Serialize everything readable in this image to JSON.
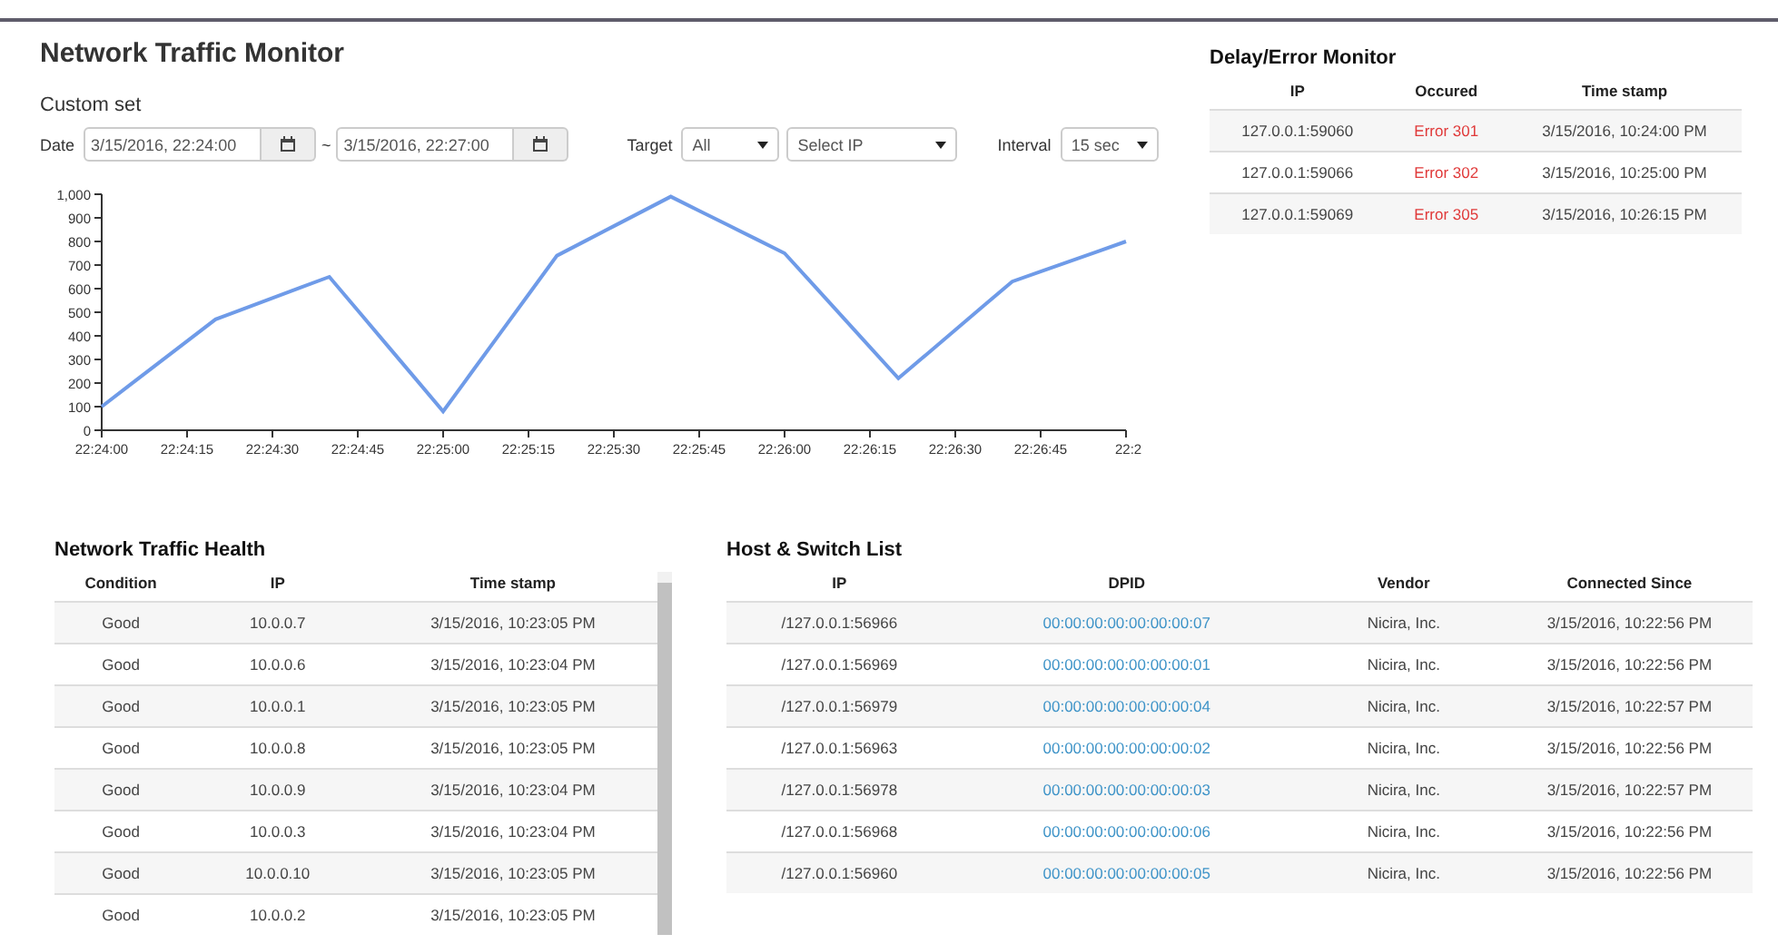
{
  "title": "Network Traffic Monitor",
  "custom_set": {
    "label": "Custom set",
    "date_label": "Date",
    "date_from": "3/15/2016, 22:24:00",
    "separator": "~",
    "date_to": "3/15/2016, 22:27:00",
    "target_label": "Target",
    "target_value": "All",
    "ip_placeholder": "Select IP",
    "interval_label": "Interval",
    "interval_value": "15 sec"
  },
  "chart": {
    "chart_data": {
      "type": "line",
      "categories": [
        "22:24:00",
        null,
        null,
        "22:24:15",
        null,
        null,
        "22:24:30",
        null,
        null,
        "22:24:45",
        null,
        null,
        "22:25:00",
        null,
        null,
        "22:25:15",
        null,
        null,
        "22:25:30",
        null,
        null,
        "22:25:45",
        null,
        null,
        "22:26:00",
        null,
        null,
        "22:26:15",
        null,
        null,
        "22:26:30",
        null,
        null,
        "22:26:45",
        null,
        null,
        "22:2"
      ],
      "series": [
        {
          "color": "#6f9be8",
          "values": [
            100,
            192.5,
            285,
            377.5,
            470,
            515,
            560,
            605,
            650,
            507.5,
            365,
            222.5,
            80,
            245,
            410,
            575,
            740,
            802.5,
            865,
            927.5,
            990,
            930,
            870,
            810,
            750,
            617.5,
            485,
            352.5,
            220,
            322.5,
            425,
            527.5,
            630,
            672.5,
            715,
            757.5,
            800
          ]
        }
      ],
      "ylim": [
        0,
        1000
      ],
      "yticks": [
        {
          "value": 0,
          "label": "0"
        },
        {
          "value": 100,
          "label": "100"
        },
        {
          "value": 200,
          "label": "200"
        },
        {
          "value": 300,
          "label": "300"
        },
        {
          "value": 400,
          "label": "400"
        },
        {
          "value": 500,
          "label": "500"
        },
        {
          "value": 600,
          "label": "600"
        },
        {
          "value": 700,
          "label": "700"
        },
        {
          "value": 800,
          "label": "800"
        },
        {
          "value": 900,
          "label": "900"
        },
        {
          "value": 1000,
          "label": "1,000"
        }
      ]
    }
  },
  "delay_error_monitor": {
    "title": "Delay/Error Monitor",
    "columns": [
      {
        "label": "IP",
        "kind": "text"
      },
      {
        "label": "Occured",
        "kind": "error"
      },
      {
        "label": "Time stamp",
        "kind": "text"
      }
    ],
    "rows": [
      [
        "127.0.0.1:59060",
        "Error 301",
        "3/15/2016, 10:24:00 PM"
      ],
      [
        "127.0.0.1:59066",
        "Error 302",
        "3/15/2016, 10:25:00 PM"
      ],
      [
        "127.0.0.1:59069",
        "Error 305",
        "3/15/2016, 10:26:15 PM"
      ]
    ]
  },
  "network_traffic_health": {
    "title": "Network Traffic Health",
    "columns": [
      {
        "label": "Condition"
      },
      {
        "label": "IP"
      },
      {
        "label": "Time stamp"
      }
    ],
    "rows": [
      [
        "Good",
        "10.0.0.7",
        "3/15/2016, 10:23:05 PM"
      ],
      [
        "Good",
        "10.0.0.6",
        "3/15/2016, 10:23:04 PM"
      ],
      [
        "Good",
        "10.0.0.1",
        "3/15/2016, 10:23:05 PM"
      ],
      [
        "Good",
        "10.0.0.8",
        "3/15/2016, 10:23:05 PM"
      ],
      [
        "Good",
        "10.0.0.9",
        "3/15/2016, 10:23:04 PM"
      ],
      [
        "Good",
        "10.0.0.3",
        "3/15/2016, 10:23:04 PM"
      ],
      [
        "Good",
        "10.0.0.10",
        "3/15/2016, 10:23:05 PM"
      ],
      [
        "Good",
        "10.0.0.2",
        "3/15/2016, 10:23:05 PM"
      ]
    ]
  },
  "host_switch_list": {
    "title": "Host & Switch List",
    "columns": [
      {
        "label": "IP",
        "kind": "text"
      },
      {
        "label": "DPID",
        "kind": "link"
      },
      {
        "label": "Vendor",
        "kind": "text"
      },
      {
        "label": "Connected Since",
        "kind": "text"
      }
    ],
    "rows": [
      [
        "/127.0.0.1:56966",
        "00:00:00:00:00:00:00:07",
        "Nicira, Inc.",
        "3/15/2016, 10:22:56 PM"
      ],
      [
        "/127.0.0.1:56969",
        "00:00:00:00:00:00:00:01",
        "Nicira, Inc.",
        "3/15/2016, 10:22:56 PM"
      ],
      [
        "/127.0.0.1:56979",
        "00:00:00:00:00:00:00:04",
        "Nicira, Inc.",
        "3/15/2016, 10:22:57 PM"
      ],
      [
        "/127.0.0.1:56963",
        "00:00:00:00:00:00:00:02",
        "Nicira, Inc.",
        "3/15/2016, 10:22:56 PM"
      ],
      [
        "/127.0.0.1:56978",
        "00:00:00:00:00:00:00:03",
        "Nicira, Inc.",
        "3/15/2016, 10:22:57 PM"
      ],
      [
        "/127.0.0.1:56968",
        "00:00:00:00:00:00:00:06",
        "Nicira, Inc.",
        "3/15/2016, 10:22:56 PM"
      ],
      [
        "/127.0.0.1:56960",
        "00:00:00:00:00:00:00:05",
        "Nicira, Inc.",
        "3/15/2016, 10:22:56 PM"
      ]
    ]
  }
}
